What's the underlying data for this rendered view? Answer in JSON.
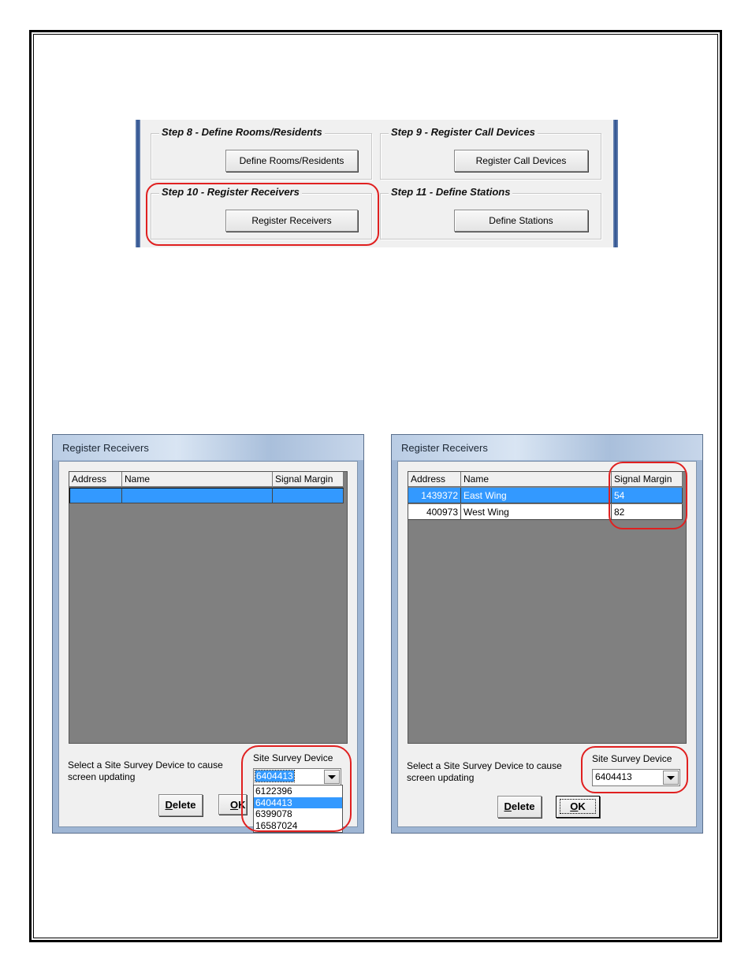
{
  "wizard": {
    "step8": {
      "legend": "Step 8 - Define Rooms/Residents",
      "button": "Define Rooms/Residents"
    },
    "step9": {
      "legend": "Step 9 - Register Call Devices",
      "button": "Register Call Devices"
    },
    "step10": {
      "legend": "Step 10 - Register Receivers",
      "button": "Register Receivers"
    },
    "step11": {
      "legend": "Step 11 - Define Stations",
      "button": "Define Stations"
    }
  },
  "dialog_left": {
    "title": "Register Receivers",
    "columns": [
      "Address",
      "Name",
      "Signal Margin"
    ],
    "rows": [
      {
        "address": "",
        "name": "",
        "signal": ""
      }
    ],
    "instruction_line1": "Select a Site Survey Device to cause",
    "instruction_line2": "screen updating",
    "device_label": "Site Survey Device",
    "device_value": "6404413",
    "device_options": [
      "6122396",
      "6404413",
      "6399078",
      "16587024"
    ],
    "delete_first": "D",
    "delete_rest": "elete",
    "ok_first": "O",
    "ok_rest": "K"
  },
  "dialog_right": {
    "title": "Register Receivers",
    "columns": [
      "Address",
      "Name",
      "Signal Margin"
    ],
    "rows": [
      {
        "address": "1439372",
        "name": "East Wing",
        "signal": "54"
      },
      {
        "address": "400973",
        "name": "West Wing",
        "signal": "82"
      }
    ],
    "instruction_line1": "Select a Site Survey Device to cause",
    "instruction_line2": "screen updating",
    "device_label": "Site Survey Device",
    "device_value": "6404413",
    "delete_first": "D",
    "delete_rest": "elete",
    "ok_first": "O",
    "ok_rest": "K"
  },
  "colors": {
    "highlight": "#e02020",
    "selection": "#3399ff",
    "grid_bg": "#808080"
  }
}
